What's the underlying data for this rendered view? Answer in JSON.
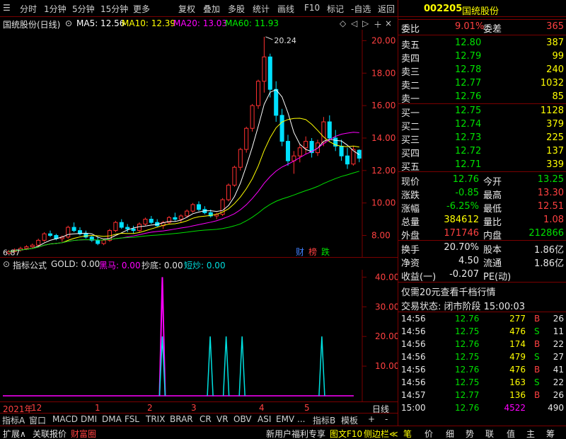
{
  "toolbar": {
    "items": [
      "分时",
      "1分钟",
      "5分钟",
      "15分钟",
      "更多",
      "复权",
      "叠加",
      "多股",
      "统计",
      "画线",
      "F10",
      "标记",
      "-自选",
      "返回"
    ]
  },
  "stock": {
    "code": "002205",
    "name": "国统股份"
  },
  "chart_header": {
    "title": "国统股份(日线)",
    "ma5": "MA5: 12.56",
    "ma10": "MA10: 12.39",
    "ma20": "MA20: 13.03",
    "ma60": "MA60: 11.93"
  },
  "colors": {
    "up": "#ff3030",
    "down": "#00e0ff",
    "ma5": "#ffffff",
    "ma10": "#ffff00",
    "ma20": "#ff00ff",
    "ma60": "#00e000",
    "grid": "#7a0000"
  },
  "main_chart": {
    "y_ticks": [
      "20.00",
      "18.00",
      "16.00",
      "14.00",
      "12.00",
      "10.00",
      "8.00"
    ],
    "high_label": "20.24",
    "low_label": "6.87",
    "badges": [
      "财",
      "榜",
      "跌"
    ]
  },
  "indicator": {
    "header_title": "指标公式",
    "gold": "GOLD: 0.00",
    "heima": "黑马: 0.00",
    "chaodi": "抄底: 0.00",
    "duanchao": "短炒: 0.00",
    "y_ticks": [
      "40.00",
      "30.00",
      "20.00",
      "10.00"
    ]
  },
  "time_axis": {
    "labels": [
      "2021年",
      "12",
      "1",
      "2",
      "3",
      "4",
      "5"
    ],
    "right_label": "日线"
  },
  "tabs": [
    "指标A",
    "窗口",
    "MACD",
    "DMI",
    "DMA",
    "FSL",
    "TRIX",
    "BRAR",
    "CR",
    "VR",
    "OBV",
    "ASI",
    "EMV",
    "...",
    "指标B",
    "模板",
    "+",
    "-"
  ],
  "bottombar": {
    "left": [
      "扩展∧",
      "关联报价",
      "财富圈"
    ],
    "mid": "新用户福利专享",
    "mid2": "图文F10",
    "mid3": "侧边栏≪",
    "right": [
      "笔",
      "价",
      "细",
      "势",
      "联",
      "值",
      "主",
      "筹"
    ]
  },
  "quote": {
    "weibi_label": "委比",
    "weibi": "9.01%",
    "weicha_label": "委差",
    "weicha": "365",
    "sell": [
      {
        "label": "卖五",
        "price": "12.80",
        "vol": "387"
      },
      {
        "label": "卖四",
        "price": "12.79",
        "vol": "99"
      },
      {
        "label": "卖三",
        "price": "12.78",
        "vol": "240"
      },
      {
        "label": "卖二",
        "price": "12.77",
        "vol": "1032"
      },
      {
        "label": "卖一",
        "price": "12.76",
        "vol": "85"
      }
    ],
    "buy": [
      {
        "label": "买一",
        "price": "12.75",
        "vol": "1128"
      },
      {
        "label": "买二",
        "price": "12.74",
        "vol": "379"
      },
      {
        "label": "买三",
        "price": "12.73",
        "vol": "225"
      },
      {
        "label": "买四",
        "price": "12.72",
        "vol": "137"
      },
      {
        "label": "买五",
        "price": "12.71",
        "vol": "339"
      }
    ],
    "stats": [
      {
        "l1": "现价",
        "v1": "12.76",
        "l2": "今开",
        "v2": "13.25"
      },
      {
        "l1": "涨跌",
        "v1": "-0.85",
        "l2": "最高",
        "v2": "13.30"
      },
      {
        "l1": "涨幅",
        "v1": "-6.25%",
        "l2": "最低",
        "v2": "12.51"
      },
      {
        "l1": "总量",
        "v1": "384612",
        "l2": "量比",
        "v2": "1.08"
      },
      {
        "l1": "外盘",
        "v1": "171746",
        "l2": "内盘",
        "v2": "212866"
      }
    ],
    "stats2": [
      {
        "l1": "换手",
        "v1": "20.70%",
        "l2": "股本",
        "v2": "1.86亿"
      },
      {
        "l1": "净资",
        "v1": "4.50",
        "l2": "流通",
        "v2": "1.86亿"
      },
      {
        "l1": "收益(一)",
        "v1": "-0.207",
        "l2": "PE(动)",
        "v2": ""
      }
    ],
    "promo": "仅需20元查看千档行情",
    "trade_status": "交易状态: 闭市阶段 15:00:03"
  },
  "ticks": [
    {
      "t": "14:56",
      "p": "12.76",
      "v": "277",
      "s": "B",
      "n": "26"
    },
    {
      "t": "14:56",
      "p": "12.75",
      "v": "476",
      "s": "S",
      "n": "11"
    },
    {
      "t": "14:56",
      "p": "12.76",
      "v": "174",
      "s": "B",
      "n": "22"
    },
    {
      "t": "14:56",
      "p": "12.75",
      "v": "479",
      "s": "S",
      "n": "27"
    },
    {
      "t": "14:56",
      "p": "12.76",
      "v": "476",
      "s": "B",
      "n": "41"
    },
    {
      "t": "14:56",
      "p": "12.75",
      "v": "163",
      "s": "S",
      "n": "22"
    },
    {
      "t": "14:57",
      "p": "12.77",
      "v": "136",
      "s": "B",
      "n": "26"
    },
    {
      "t": "15:00",
      "p": "12.76",
      "v": "4522",
      "s": "",
      "n": "490"
    }
  ],
  "chart_data": {
    "type": "candlestick",
    "y_range": [
      6.8,
      20.5
    ],
    "ma_visible": [
      "MA5",
      "MA10",
      "MA20",
      "MA60"
    ],
    "ohlc": [
      [
        6.9,
        7.1,
        6.85,
        7.0
      ],
      [
        7.0,
        7.2,
        6.95,
        7.1
      ],
      [
        7.1,
        7.3,
        7.0,
        7.2
      ],
      [
        7.2,
        7.4,
        7.1,
        7.3
      ],
      [
        7.3,
        7.5,
        7.2,
        7.4
      ],
      [
        7.4,
        7.8,
        7.3,
        7.7
      ],
      [
        7.7,
        8.2,
        7.6,
        8.1
      ],
      [
        8.1,
        8.3,
        7.9,
        8.0
      ],
      [
        8.0,
        8.1,
        7.7,
        7.8
      ],
      [
        7.8,
        8.0,
        7.6,
        7.9
      ],
      [
        7.9,
        8.6,
        7.8,
        8.5
      ],
      [
        8.5,
        8.8,
        8.2,
        8.3
      ],
      [
        8.3,
        8.5,
        8.0,
        8.1
      ],
      [
        8.1,
        8.3,
        7.8,
        7.9
      ],
      [
        7.9,
        8.0,
        7.6,
        7.7
      ],
      [
        7.7,
        7.9,
        7.4,
        7.5
      ],
      [
        7.5,
        7.8,
        7.4,
        7.7
      ],
      [
        7.7,
        8.4,
        7.6,
        8.3
      ],
      [
        8.3,
        8.9,
        8.2,
        8.8
      ],
      [
        8.8,
        9.0,
        8.4,
        8.5
      ],
      [
        8.5,
        8.7,
        8.2,
        8.4
      ],
      [
        8.4,
        8.6,
        8.1,
        8.3
      ],
      [
        8.3,
        8.8,
        8.2,
        8.7
      ],
      [
        8.7,
        9.1,
        8.6,
        9.0
      ],
      [
        9.0,
        9.2,
        8.7,
        8.8
      ],
      [
        8.8,
        9.0,
        8.5,
        8.6
      ],
      [
        8.6,
        8.9,
        8.4,
        8.8
      ],
      [
        8.8,
        9.2,
        8.7,
        9.1
      ],
      [
        9.1,
        9.4,
        8.9,
        9.0
      ],
      [
        9.0,
        9.3,
        8.8,
        9.2
      ],
      [
        9.2,
        9.6,
        9.1,
        9.5
      ],
      [
        9.5,
        10.0,
        9.4,
        9.9
      ],
      [
        9.9,
        10.1,
        9.5,
        9.6
      ],
      [
        9.6,
        9.8,
        9.3,
        9.4
      ],
      [
        9.4,
        9.6,
        9.1,
        9.2
      ],
      [
        9.2,
        9.4,
        9.0,
        9.3
      ],
      [
        9.3,
        10.3,
        9.2,
        10.2
      ],
      [
        10.2,
        11.2,
        10.1,
        11.1
      ],
      [
        11.1,
        12.3,
        11.0,
        12.2
      ],
      [
        12.2,
        13.4,
        12.0,
        13.3
      ],
      [
        13.3,
        14.7,
        13.1,
        14.6
      ],
      [
        14.6,
        16.1,
        14.4,
        16.0
      ],
      [
        16.0,
        17.6,
        15.8,
        17.5
      ],
      [
        17.5,
        20.24,
        16.8,
        19.0
      ],
      [
        19.0,
        19.2,
        16.5,
        17.0
      ],
      [
        17.0,
        17.5,
        15.0,
        15.4
      ],
      [
        15.4,
        15.8,
        13.5,
        13.8
      ],
      [
        13.8,
        14.2,
        12.3,
        12.6
      ],
      [
        12.6,
        13.2,
        11.8,
        12.9
      ],
      [
        12.9,
        13.6,
        12.5,
        13.4
      ],
      [
        13.4,
        14.1,
        13.0,
        13.8
      ],
      [
        13.8,
        14.0,
        12.8,
        13.1
      ],
      [
        13.1,
        13.9,
        12.9,
        13.7
      ],
      [
        13.7,
        15.3,
        13.5,
        15.0
      ],
      [
        15.0,
        15.4,
        13.8,
        14.0
      ],
      [
        14.0,
        14.5,
        13.2,
        13.5
      ],
      [
        13.5,
        13.9,
        12.6,
        12.9
      ],
      [
        12.9,
        13.4,
        12.1,
        12.4
      ],
      [
        12.4,
        13.5,
        12.3,
        13.3
      ],
      [
        13.25,
        13.3,
        12.51,
        12.76
      ]
    ],
    "indicator_series": [
      {
        "name": "黑马",
        "color": "#ff00ff",
        "spikes": [
          {
            "index": 30,
            "value": 40
          }
        ]
      },
      {
        "name": "短炒",
        "color": "#00e0e0",
        "spikes": [
          {
            "index": 30,
            "value": 20
          },
          {
            "index": 39,
            "value": 20
          },
          {
            "index": 42,
            "value": 20
          },
          {
            "index": 45,
            "value": 20
          },
          {
            "index": 60,
            "value": 20
          }
        ]
      }
    ],
    "indicator_ylim": [
      0,
      42
    ]
  }
}
